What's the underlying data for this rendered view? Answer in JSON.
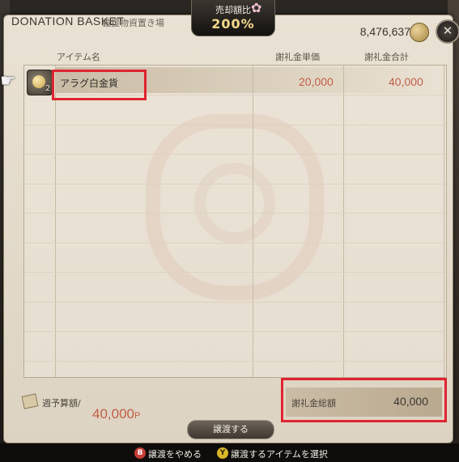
{
  "window": {
    "title_en": "DONATION BASKET",
    "title_jp": "義援物資置き場"
  },
  "sell_rate": {
    "label": "売却額比",
    "value": "200%"
  },
  "gil": "8,476,637",
  "table": {
    "headers": {
      "item": "アイテム名",
      "unit": "謝礼金単価",
      "total": "謝礼金合計"
    },
    "rows": [
      {
        "name": "アラグ白金貨",
        "quantity": "2",
        "unit_price": "20,000",
        "total_price": "40,000"
      }
    ]
  },
  "footer": {
    "budget_label": "週予算額/",
    "budget_value": "40,000",
    "currency_symbol": "P",
    "total_label": "謝礼金総額",
    "total_value": "40,000",
    "confirm_label": "譲渡する"
  },
  "hints": {
    "b_key": "B",
    "cancel": "譲渡をやめる",
    "y_key": "Y",
    "select": "譲渡するアイテムを選択"
  },
  "icons": [
    "hand-cursor-icon",
    "coin-icon",
    "close-icon",
    "platinum-coin-icon",
    "budget-book-icon",
    "sakura-icon"
  ],
  "colors": {
    "accent_red": "#c15f4a",
    "highlight_box": "#e02430",
    "rate_gold": "#f4d98c"
  }
}
